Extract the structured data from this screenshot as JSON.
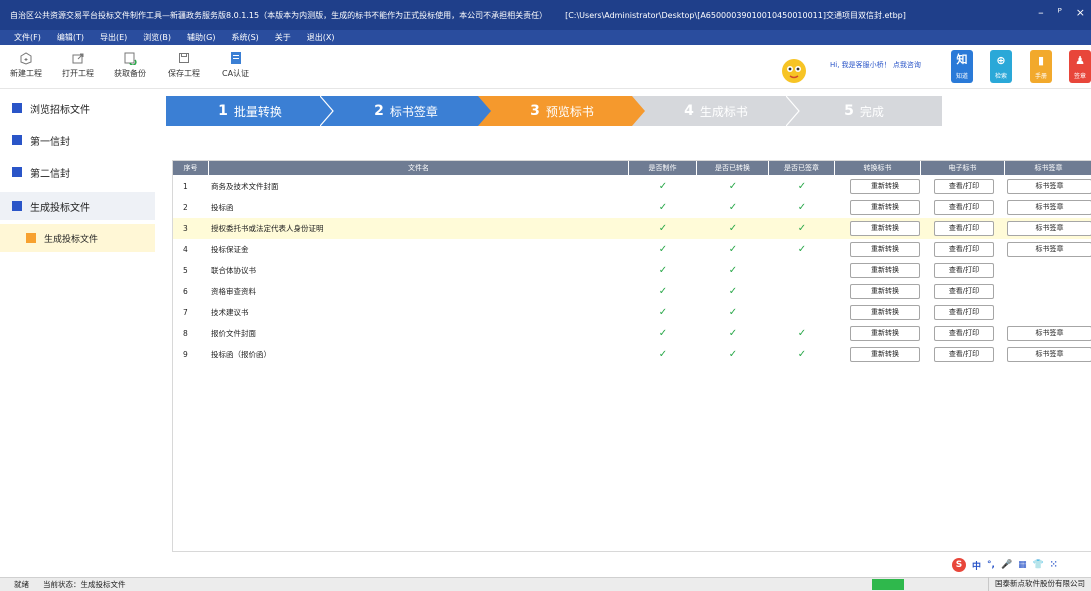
{
  "window": {
    "title": "自治区公共资源交易平台投标文件制作工具—新疆政务服务版8.0.1.15（本版本为内测版，生成的标书不能作为正式投标使用，本公司不承担相关责任）",
    "path": "[C:\\Users\\Administrator\\Desktop\\[A65000039010010450010011]交通项目双信封.etbp]",
    "minimize": "–",
    "restore": "ᴾ",
    "close": "×"
  },
  "menu": [
    "文件(F)",
    "编辑(T)",
    "导出(E)",
    "浏览(B)",
    "辅助(G)",
    "系统(S)",
    "关于",
    "退出(X)"
  ],
  "toolbar": {
    "new_label": "新建工程",
    "open_label": "打开工程",
    "backup_label": "获取备份",
    "save_label": "保存工程",
    "ca_label": "CA认证",
    "hi_text": "Hi, 我是客服小桥！ 点我咨询",
    "right_buttons": [
      {
        "label": "知道",
        "glyph": "知",
        "color": "#2a7ad8"
      },
      {
        "label": "检索",
        "glyph": "⊕",
        "color": "#2aa8d8"
      },
      {
        "label": "手册",
        "glyph": "▮",
        "color": "#f2a92c"
      },
      {
        "label": "签章",
        "glyph": "♟",
        "color": "#e8463a"
      }
    ]
  },
  "sidebar": {
    "items": [
      {
        "label": "浏览招标文件"
      },
      {
        "label": "第一信封"
      },
      {
        "label": "第二信封"
      },
      {
        "label": "生成投标文件"
      },
      {
        "label": "生成投标文件"
      }
    ]
  },
  "steps": [
    {
      "num": "1",
      "label": "批量转换",
      "state": "done",
      "color": "#3b7fd4"
    },
    {
      "num": "2",
      "label": "标书签章",
      "state": "done",
      "color": "#3b7fd4"
    },
    {
      "num": "3",
      "label": "预览标书",
      "state": "active",
      "color": "#f5992d"
    },
    {
      "num": "4",
      "label": "生成标书",
      "state": "todo",
      "color": "#d6d8dc"
    },
    {
      "num": "5",
      "label": "完成",
      "state": "todo",
      "color": "#d6d8dc"
    }
  ],
  "table": {
    "headers": [
      "序号",
      "文件名",
      "是否制作",
      "是否已转换",
      "是否已签章",
      "转换标书",
      "电子标书",
      "标书签章"
    ],
    "check_glyph": "✓",
    "convert_label": "重新转换",
    "view_label": "查看/打印",
    "sign_label": "标书签章",
    "rows": [
      {
        "no": "1",
        "name": "商务及技术文件封面",
        "made": true,
        "converted": true,
        "signed": true,
        "sign_btn": true
      },
      {
        "no": "2",
        "name": "投标函",
        "made": true,
        "converted": true,
        "signed": true,
        "sign_btn": true
      },
      {
        "no": "3",
        "name": "授权委托书或法定代表人身份证明",
        "made": true,
        "converted": true,
        "signed": true,
        "sign_btn": true,
        "highlight": true
      },
      {
        "no": "4",
        "name": "投标保证金",
        "made": true,
        "converted": true,
        "signed": true,
        "sign_btn": true
      },
      {
        "no": "5",
        "name": "联合体协议书",
        "made": true,
        "converted": true,
        "signed": false,
        "sign_btn": false
      },
      {
        "no": "6",
        "name": "资格审查资料",
        "made": true,
        "converted": true,
        "signed": false,
        "sign_btn": false
      },
      {
        "no": "7",
        "name": "技术建议书",
        "made": true,
        "converted": true,
        "signed": false,
        "sign_btn": false
      },
      {
        "no": "8",
        "name": "报价文件封面",
        "made": true,
        "converted": true,
        "signed": true,
        "sign_btn": true
      },
      {
        "no": "9",
        "name": "投标函（报价函）",
        "made": true,
        "converted": true,
        "signed": true,
        "sign_btn": true
      }
    ]
  },
  "statusbar": {
    "ready": "就绪",
    "state_label": "当前状态：",
    "state_value": "生成投标文件",
    "company": "国泰新点软件股份有限公司"
  },
  "ime": {
    "logo": "S",
    "items": [
      "中",
      "°,",
      "🎤",
      "▦",
      "👕",
      "⁙"
    ]
  }
}
